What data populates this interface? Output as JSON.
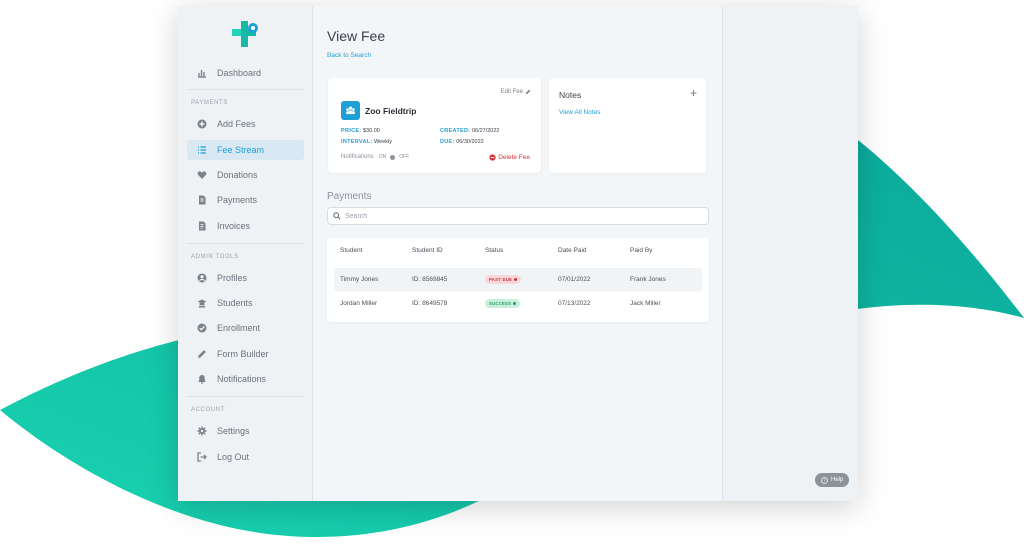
{
  "colors": {
    "accent": "#1f9fd6",
    "teal": "#14b8a6",
    "danger": "#d9363e",
    "success": "#1f9d62"
  },
  "sidebar": {
    "logo_icon": "medical-cross-logo-icon",
    "items_top": [
      {
        "label": "Dashboard",
        "icon": "chart-icon"
      }
    ],
    "sections": [
      {
        "label": "PAYMENTS",
        "items": [
          {
            "label": "Add Fees",
            "icon": "plus-circle-icon"
          },
          {
            "label": "Fee Stream",
            "icon": "list-icon",
            "active": true
          },
          {
            "label": "Donations",
            "icon": "heart-icon"
          },
          {
            "label": "Payments",
            "icon": "document-icon"
          },
          {
            "label": "Invoices",
            "icon": "invoice-icon"
          }
        ]
      },
      {
        "label": "ADMIN TOOLS",
        "items": [
          {
            "label": "Profiles",
            "icon": "user-circle-icon"
          },
          {
            "label": "Students",
            "icon": "graduation-cap-icon"
          },
          {
            "label": "Enrollment",
            "icon": "check-circle-icon"
          },
          {
            "label": "Form Builder",
            "icon": "pencil-icon"
          },
          {
            "label": "Notifications",
            "icon": "bell-icon"
          }
        ]
      },
      {
        "label": "ACCOUNT",
        "items": [
          {
            "label": "Settings",
            "icon": "gear-icon"
          },
          {
            "label": "Log Out",
            "icon": "logout-icon"
          }
        ]
      }
    ]
  },
  "main": {
    "title": "View Fee",
    "back_link": "Back to Search",
    "fee": {
      "edit_label": "Edit Fee",
      "name": "Zoo Fieldtrip",
      "price_key": "PRICE:",
      "price_val": "$30.00",
      "interval_key": "INTERVAL:",
      "interval_val": "Weekly",
      "created_key": "CREATED:",
      "created_val": "06/27/2022",
      "due_key": "DUE:",
      "due_val": "06/30/2022",
      "notifications_label": "Notifications",
      "on_label": "ON",
      "off_label": "OFF",
      "delete_label": "Delete Fee"
    },
    "notes": {
      "title": "Notes",
      "add": "+",
      "link": "View All Notes"
    },
    "payments": {
      "title": "Payments",
      "search_placeholder": "Search",
      "columns": [
        "Student",
        "Student ID",
        "Status",
        "Date Paid",
        "Paid By"
      ],
      "rows": [
        {
          "student": "Timmy Jones",
          "student_id": "ID: 8569845",
          "status": "PAST DUE",
          "status_type": "past",
          "date_paid": "07/01/2022",
          "paid_by": "Frank Jones"
        },
        {
          "student": "Jordan Miller",
          "student_id": "ID: 8649578",
          "status": "SUCCESS",
          "status_type": "success",
          "date_paid": "07/13/2022",
          "paid_by": "Jack Miller"
        }
      ]
    }
  },
  "help": {
    "label": "Help"
  }
}
